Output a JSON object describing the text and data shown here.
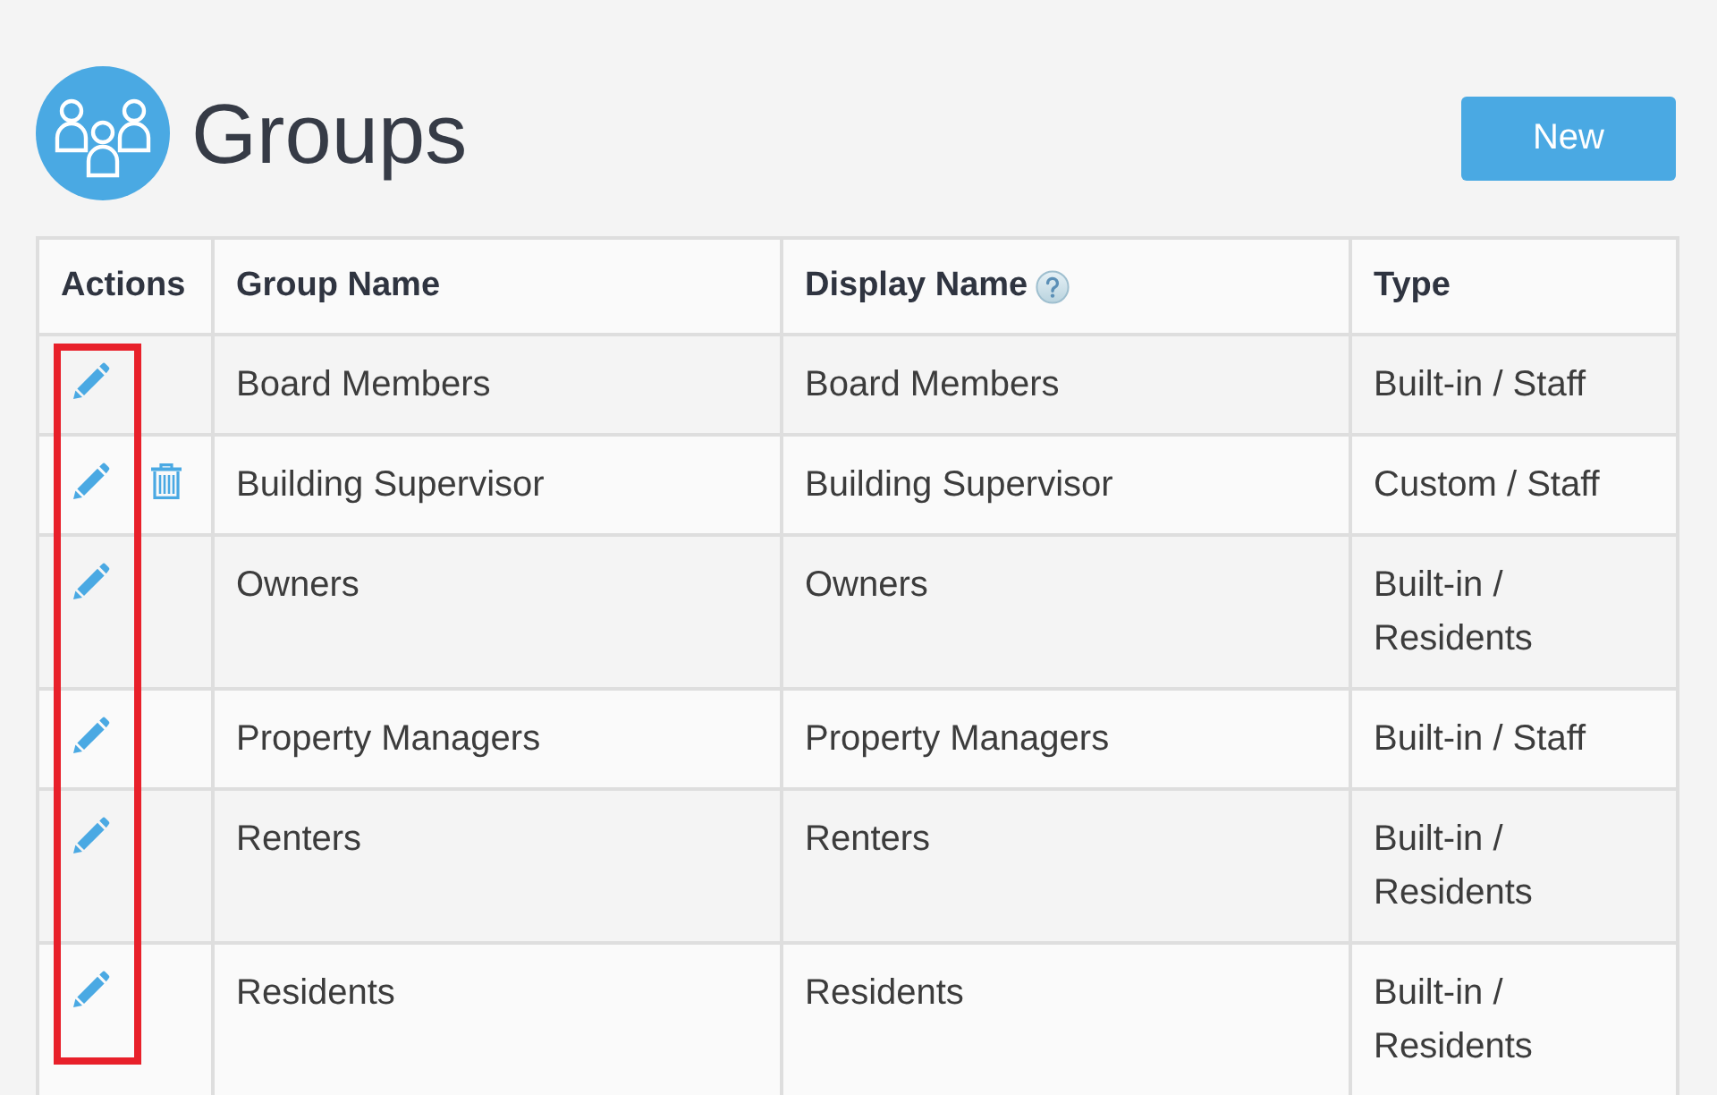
{
  "header": {
    "title": "Groups",
    "new_button": "New"
  },
  "table": {
    "actions_highlighted": true,
    "columns": [
      {
        "label": "Actions",
        "help": false
      },
      {
        "label": "Group Name",
        "help": false
      },
      {
        "label": "Display Name",
        "help": true
      },
      {
        "label": "Type",
        "help": false
      }
    ],
    "rows": [
      {
        "actions": [
          {
            "kind": "edit"
          }
        ],
        "group_name": "Board Members",
        "display_name": "Board Members",
        "type": "Built-in / Staff"
      },
      {
        "actions": [
          {
            "kind": "edit"
          },
          {
            "kind": "delete"
          }
        ],
        "group_name": "Building Supervisor",
        "display_name": "Building Supervisor",
        "type": "Custom / Staff"
      },
      {
        "actions": [
          {
            "kind": "edit"
          }
        ],
        "group_name": "Owners",
        "display_name": "Owners",
        "type": "Built-in / Residents"
      },
      {
        "actions": [
          {
            "kind": "edit"
          }
        ],
        "group_name": "Property Managers",
        "display_name": "Property Managers",
        "type": "Built-in / Staff"
      },
      {
        "actions": [
          {
            "kind": "edit"
          }
        ],
        "group_name": "Renters",
        "display_name": "Renters",
        "type": "Built-in / Residents"
      },
      {
        "actions": [
          {
            "kind": "edit"
          }
        ],
        "group_name": "Residents",
        "display_name": "Residents",
        "type": "Built-in / Residents"
      }
    ]
  }
}
